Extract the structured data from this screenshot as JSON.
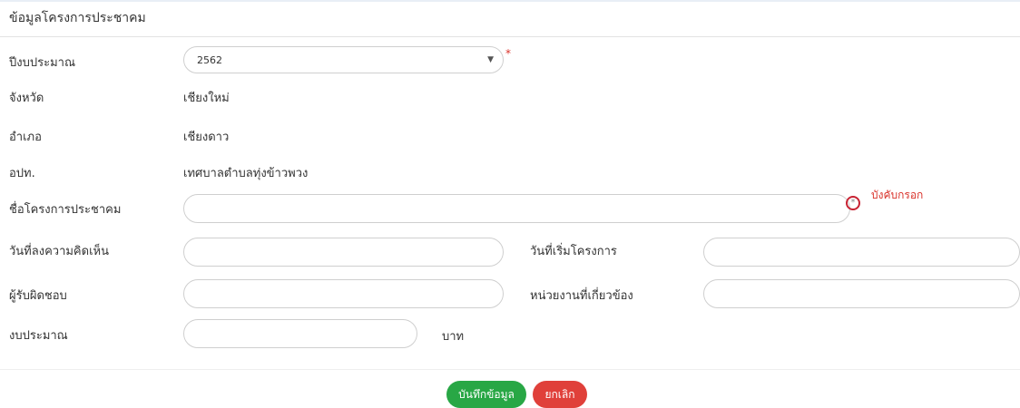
{
  "header": {
    "title": "ข้อมูลโครงการประชาคม"
  },
  "form": {
    "fiscal_year": {
      "label": "ปีงบประมาณ",
      "value": "2562",
      "required_mark": "*"
    },
    "province": {
      "label": "จังหวัด",
      "value": "เชียงใหม่"
    },
    "district": {
      "label": "อำเภอ",
      "value": "เชียงดาว"
    },
    "local_org": {
      "label": "อปท.",
      "value": "เทศบาลตำบลทุ่งข้าวพวง"
    },
    "project_name": {
      "label": "ชื่อโครงการประชาคม",
      "value": "",
      "required_mark": "*",
      "required_note": "บังคับกรอก"
    },
    "comment_date": {
      "label": "วันที่ลงความคิดเห็น",
      "value": ""
    },
    "start_date": {
      "label": "วันที่เริ่มโครงการ",
      "value": ""
    },
    "responsible": {
      "label": "ผู้รับผิดชอบ",
      "value": ""
    },
    "related_agency": {
      "label": "หน่วยงานที่เกี่ยวข้อง",
      "value": ""
    },
    "budget": {
      "label": "งบประมาณ",
      "value": "",
      "unit": "บาท"
    }
  },
  "buttons": {
    "save_label": "บันทึกข้อมูล",
    "cancel_label": "ยกเลิก"
  },
  "colors": {
    "required": "#d9322a",
    "save": "#28a745",
    "cancel": "#e0403a"
  },
  "icons": {
    "select_caret": "chevron-down-icon",
    "required_marker": "required-circle-icon"
  }
}
